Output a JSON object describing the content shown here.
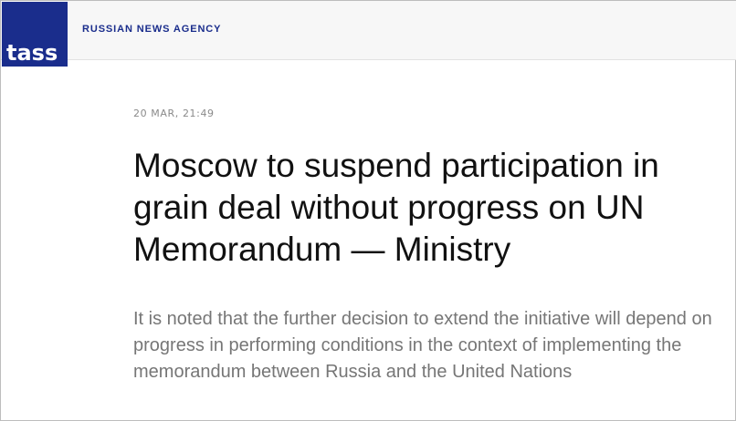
{
  "header": {
    "logo_text": "tass",
    "agency_name": "RUSSIAN NEWS AGENCY",
    "logo_color": "#1a2d8c"
  },
  "article": {
    "date": "20 MAR, 21:49",
    "title": "Moscow to suspend participation in grain deal without progress on UN Memorandum — Ministry",
    "lead": "It is noted that the further decision to extend the initiative will depend on progress in performing conditions in the context of implementing the memorandum between Russia and the United Nations"
  }
}
